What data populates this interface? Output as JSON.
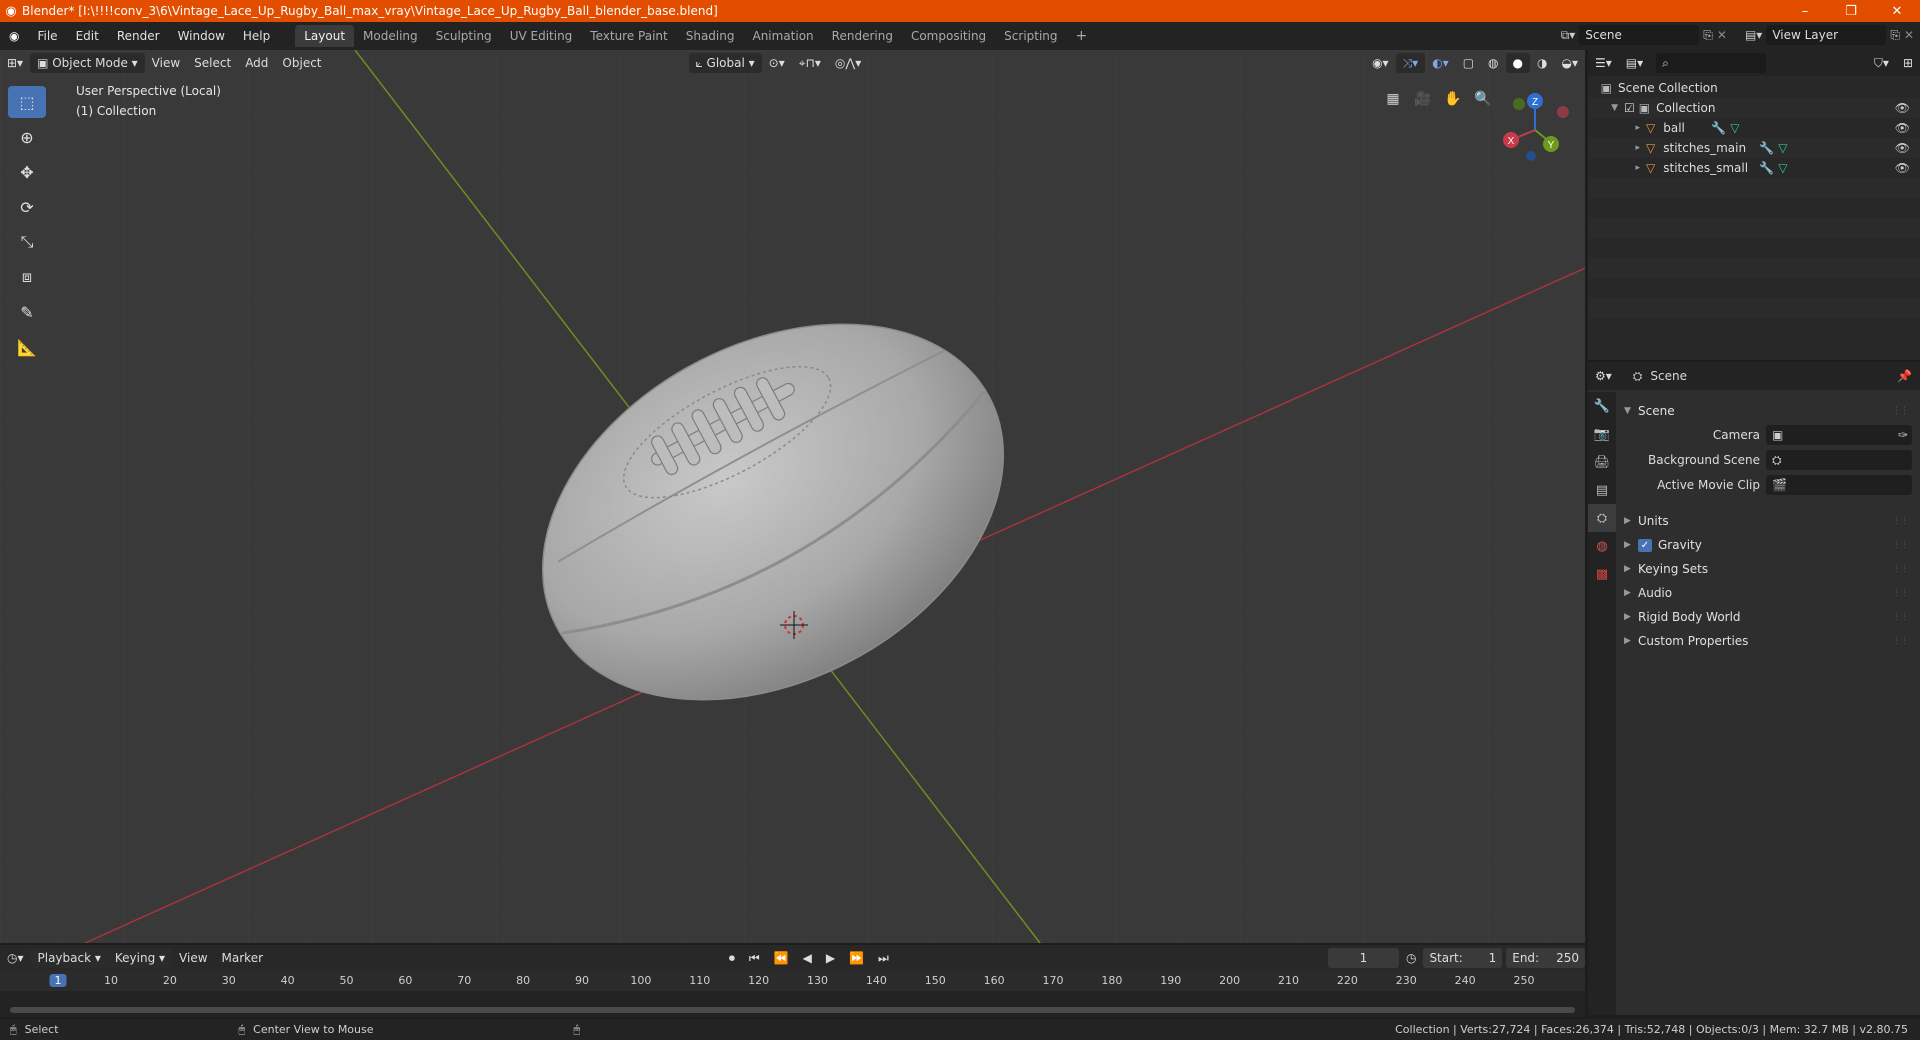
{
  "app": {
    "title": "Blender* [I:\\!!!!conv_3\\6\\Vintage_Lace_Up_Rugby_Ball_max_vray\\Vintage_Lace_Up_Rugby_Ball_blender_base.blend]",
    "menus": [
      "File",
      "Edit",
      "Render",
      "Window",
      "Help"
    ],
    "workspaces": [
      "Layout",
      "Modeling",
      "Sculpting",
      "UV Editing",
      "Texture Paint",
      "Shading",
      "Animation",
      "Rendering",
      "Compositing",
      "Scripting"
    ],
    "active_workspace": "Layout",
    "scene_name": "Scene",
    "view_layer": "View Layer",
    "window_controls": [
      "–",
      "❐",
      "✕"
    ]
  },
  "viewport": {
    "mode": "Object Mode",
    "menus": [
      "View",
      "Select",
      "Add",
      "Object"
    ],
    "transform_orientation": "Global",
    "info_line1": "User Perspective (Local)",
    "info_line2": "(1) Collection",
    "gizmo": {
      "z": "Z",
      "y": "Y",
      "x": "X"
    },
    "colors": {
      "x_axis": "#a5343c",
      "y_axis": "#6b8e23",
      "bg": "#393939",
      "accent": "#4772b3"
    }
  },
  "outliner": {
    "root": "Scene Collection",
    "collection": "Collection",
    "objects": [
      "ball",
      "stitches_main",
      "stitches_small"
    ]
  },
  "properties": {
    "context": "Scene",
    "panel": "Scene",
    "camera_label": "Camera",
    "background_scene_label": "Background Scene",
    "active_movie_clip_label": "Active Movie Clip",
    "sections": [
      "Units",
      "Gravity",
      "Keying Sets",
      "Audio",
      "Rigid Body World",
      "Custom Properties"
    ],
    "gravity_checked": true
  },
  "timeline": {
    "menus": [
      "Playback",
      "Keying",
      "View",
      "Marker"
    ],
    "current_frame": "1",
    "start_label": "Start:",
    "start": "1",
    "end_label": "End:",
    "end": "250",
    "ruler_ticks": [
      "1",
      "10",
      "20",
      "30",
      "40",
      "50",
      "60",
      "70",
      "80",
      "90",
      "100",
      "110",
      "120",
      "130",
      "140",
      "150",
      "160",
      "170",
      "180",
      "190",
      "200",
      "210",
      "220",
      "230",
      "240",
      "250"
    ]
  },
  "statusbar": {
    "select": "Select",
    "center_view": "Center View to Mouse",
    "stats": "Collection | Verts:27,724 | Faces:26,374 | Tris:52,748 | Objects:0/3 | Mem: 32.7 MB | v2.80.75"
  }
}
